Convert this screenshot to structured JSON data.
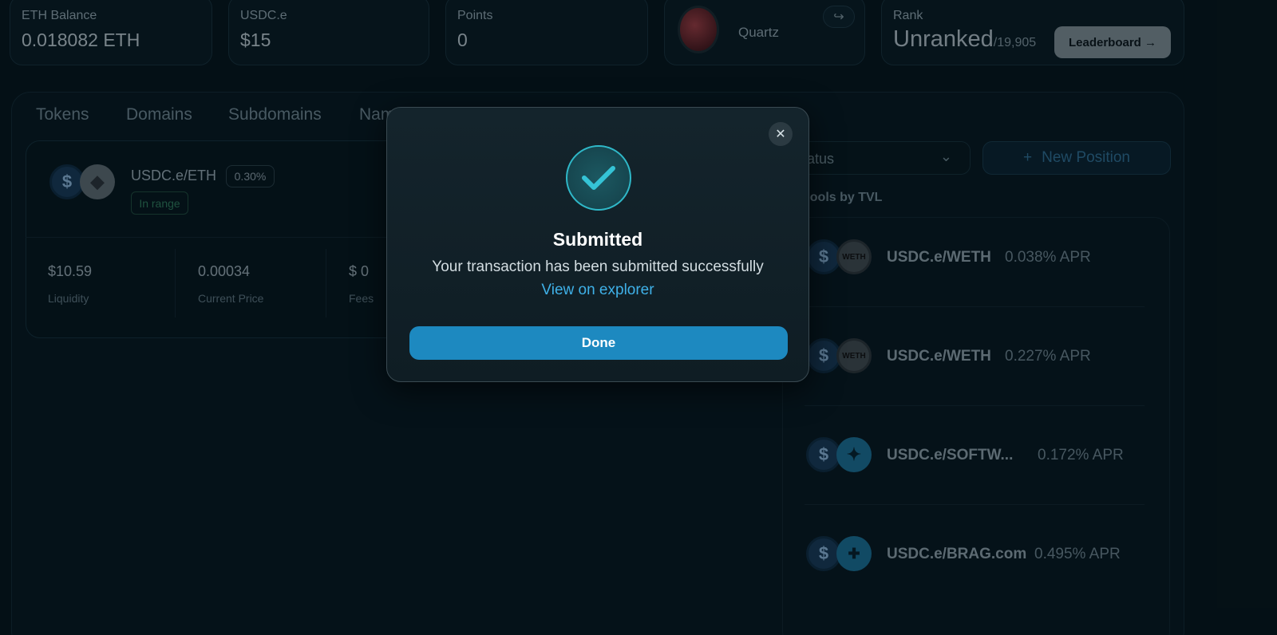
{
  "stats": {
    "eth_balance": {
      "label": "ETH Balance",
      "value": "0.018082 ETH"
    },
    "usdc": {
      "label": "USDC.e",
      "value": "$15"
    },
    "points": {
      "label": "Points",
      "value": "0"
    },
    "profile": {
      "name": "Quartz",
      "share_icon": "↪"
    },
    "rank": {
      "label": "Rank",
      "value": "Unranked",
      "total": "/19,905",
      "leaderboard_label": "Leaderboard →"
    }
  },
  "tabs": [
    "Tokens",
    "Domains",
    "Subdomains",
    "Nam"
  ],
  "position": {
    "pair": "USDC.e/ETH",
    "fee": "0.30%",
    "status": "In range",
    "stats": [
      {
        "value": "$10.59",
        "label": "Liquidity"
      },
      {
        "value": "0.00034",
        "label": "Current Price"
      },
      {
        "value": "$ 0",
        "label": "Fees"
      }
    ]
  },
  "controls": {
    "status_select": "tatus",
    "new_position": "New Position",
    "new_position_icon": "+"
  },
  "pools": {
    "title": "pools by TVL",
    "items": [
      {
        "name": "USDC.e/WETH",
        "apr": "0.038% APR",
        "token_icon": "WETH"
      },
      {
        "name": "USDC.e/WETH",
        "apr": "0.227% APR",
        "token_icon": "WETH"
      },
      {
        "name": "USDC.e/SOFTW...",
        "apr": "0.172% APR",
        "token_icon": "✦"
      },
      {
        "name": "USDC.e/BRAG.com",
        "apr": "0.495% APR",
        "token_icon": "✚"
      }
    ]
  },
  "modal": {
    "title": "Submitted",
    "message": "Your transaction has been submitted successfully",
    "link": "View on explorer",
    "done_label": "Done",
    "close_icon": "✕"
  },
  "colors": {
    "background": "#06141b",
    "accent": "#1d89c0",
    "link": "#3fb1e8",
    "success": "#2fb8c8"
  }
}
